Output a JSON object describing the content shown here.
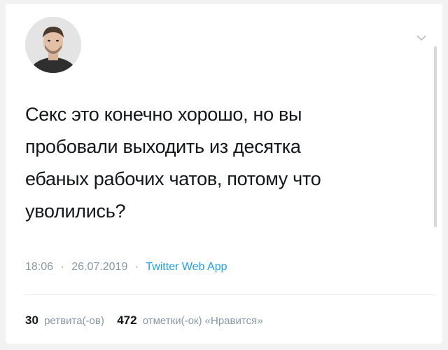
{
  "tweet": {
    "text_lines": [
      "Секс это конечно хорошо, но вы",
      "пробовали выходить из десятка",
      "ебаных рабочих чатов, потому что",
      "уволились?"
    ],
    "time": "18:06",
    "date": "26.07.2019",
    "separator": "·",
    "source": "Twitter Web App",
    "retweets_count": "30",
    "retweets_label": "ретвита(-ов)",
    "likes_count": "472",
    "likes_label": "отметки(-ок) «Нравится»"
  },
  "icons": {
    "menu": "chevron-down-icon",
    "avatar": "user-avatar"
  },
  "colors": {
    "text": "#14171a",
    "muted": "#8899a6",
    "link": "#1da1f2"
  }
}
